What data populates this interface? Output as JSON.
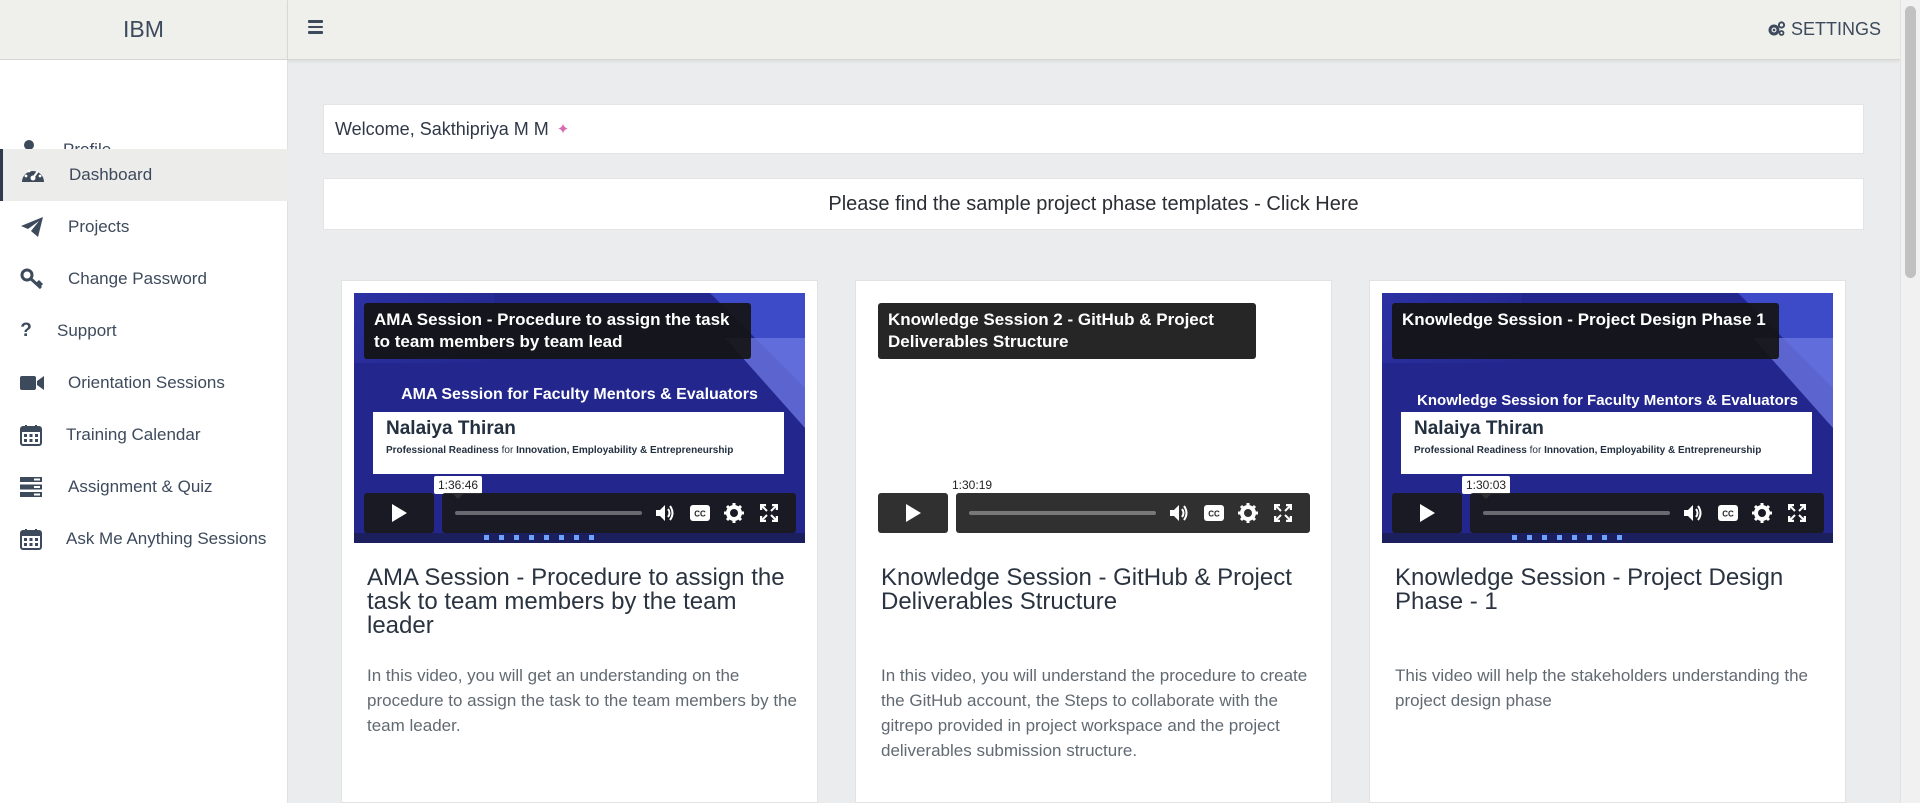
{
  "brand": {
    "title": "IBM"
  },
  "header": {
    "settings_label": "SETTINGS"
  },
  "sidebar": {
    "items": [
      {
        "label": "Profile",
        "icon": "user-icon",
        "active": false
      },
      {
        "label": "Dashboard",
        "icon": "dashboard-icon",
        "active": true
      },
      {
        "label": "Projects",
        "icon": "paper-plane-icon",
        "active": false
      },
      {
        "label": "Change Password",
        "icon": "key-icon",
        "active": false
      },
      {
        "label": "Support",
        "icon": "question-icon",
        "active": false
      },
      {
        "label": "Orientation Sessions",
        "icon": "video-camera-icon",
        "active": false
      },
      {
        "label": "Training Calendar",
        "icon": "calendar-icon",
        "active": false
      },
      {
        "label": "Assignment & Quiz",
        "icon": "list-icon",
        "active": false
      },
      {
        "label": "Ask Me Anything Sessions",
        "icon": "calendar-icon",
        "active": false
      }
    ]
  },
  "main": {
    "welcome": "Welcome, Sakthipriya M M",
    "templates_link": "Please find the sample project phase templates - Click Here",
    "cards": [
      {
        "video_title": "AMA Session - Procedure to assign the task to team members by team lead",
        "slide_heading": "AMA Session for Faculty Mentors & Evaluators",
        "slide_name": "Nalaiya Thiran",
        "slide_tagline_pre": "Professional Readiness ",
        "slide_tagline_for": "for ",
        "slide_tagline_post": "Innovation, Employability & Entrepreneurship",
        "duration": "1:36:46",
        "title": "AMA Session - Procedure to assign the task to team members by the team leader",
        "description": "In this video, you will get an understanding on the procedure to assign the task to the team members by the team leader."
      },
      {
        "video_title": "Knowledge Session 2 - GitHub & Project Deliverables Structure",
        "duration": "1:30:19",
        "title": "Knowledge Session - GitHub & Project Deliverables Structure",
        "description": "In this video, you will understand the procedure to create the GitHub account, the Steps to collaborate with the gitrepo provided in project workspace and the project deliverables submission structure."
      },
      {
        "video_title": "Knowledge Session - Project Design Phase 1",
        "slide_heading": "Knowledge Session for Faculty Mentors & Evaluators",
        "slide_name": "Nalaiya Thiran",
        "slide_tagline_pre": "Professional Readiness ",
        "slide_tagline_for": "for ",
        "slide_tagline_post": "Innovation, Employability & Entrepreneurship",
        "duration": "1:30:03",
        "title": "Knowledge Session - Project Design Phase - 1",
        "description": "This video will help the stakeholders understanding the project design phase"
      }
    ]
  },
  "colors": {
    "sidebar_bg": "#ffffff",
    "header_bg": "#efefec",
    "page_bg": "#ebecee",
    "slide_bg": "#23278d",
    "text": "#3d4a5c"
  }
}
